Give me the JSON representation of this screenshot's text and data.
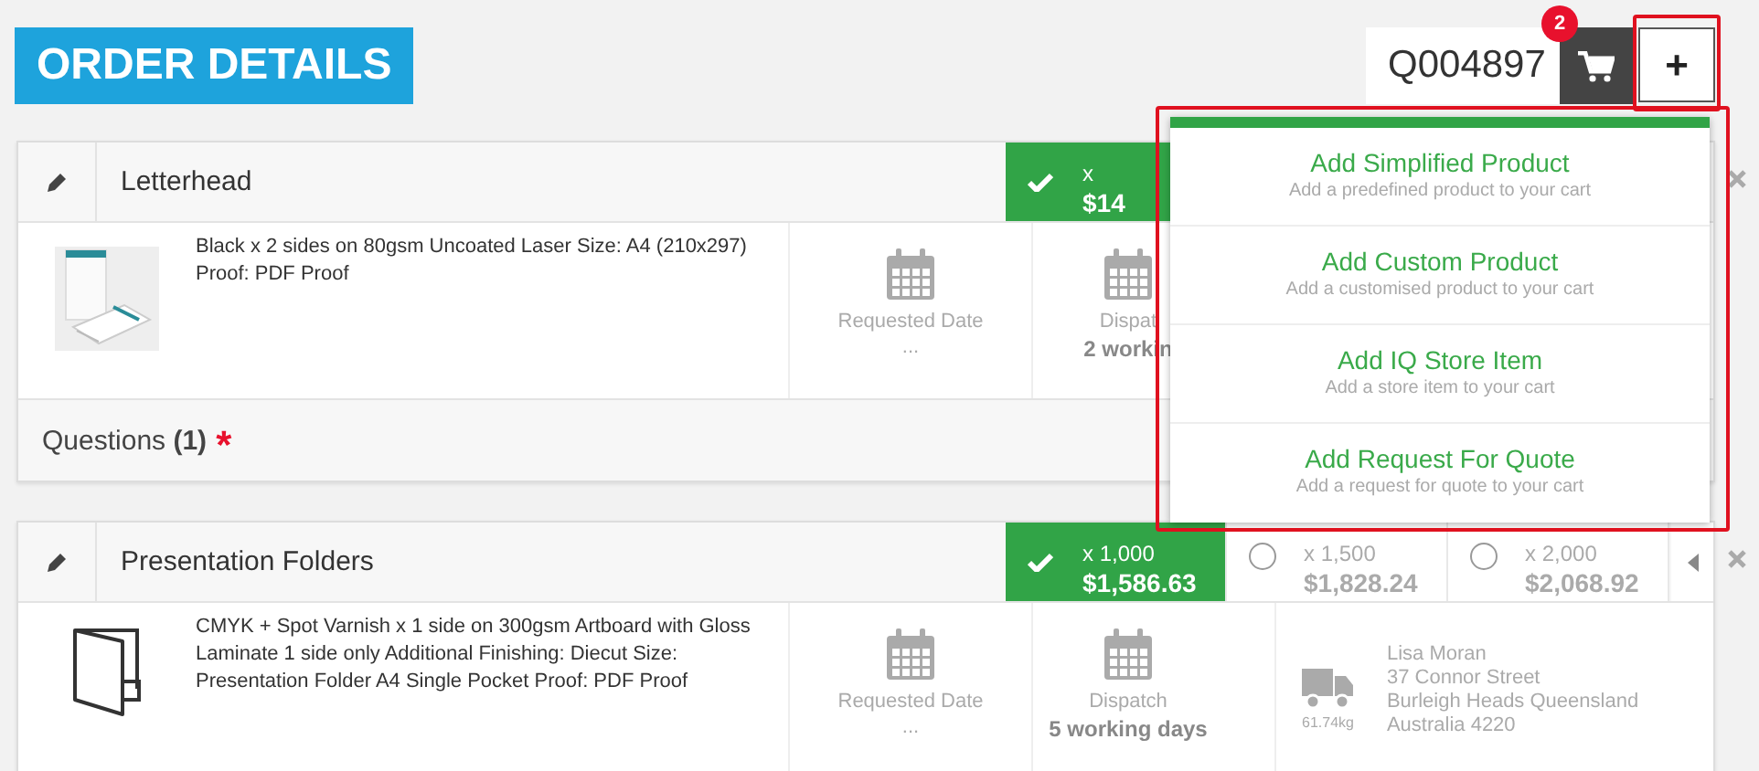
{
  "header": {
    "title": "ORDER DETAILS",
    "quote_number": "Q004897",
    "cart_count": "2",
    "add_label": "+"
  },
  "items": [
    {
      "name": "Letterhead",
      "thumbnail": {
        "kind": "picture"
      },
      "description": "Black x 2 sides on 80gsm Uncoated Laser Size: A4 (210x297) Proof: PDF Proof",
      "options": [
        {
          "quantity": "x",
          "price": "$14",
          "selected": true
        }
      ],
      "requested_label": "Requested Date",
      "requested_value": "...",
      "dispatch_label": "Dispat",
      "dispatch_value": "2 workin",
      "questions": {
        "label": "Questions **(1)**",
        "required_mark": "*"
      }
    },
    {
      "name": "Presentation Folders",
      "thumbnail": {
        "kind": "folder"
      },
      "description": "CMYK + Spot Varnish x 1 side on 300gsm Artboard with Gloss Laminate 1 side only Additional Finishing: Diecut Size: Presentation Folder A4 Single Pocket Proof: PDF Proof",
      "options": [
        {
          "quantity": "x 1,000",
          "price": "$1,586.63",
          "selected": true
        },
        {
          "quantity": "x 1,500",
          "price": "$1,828.24",
          "selected": false
        },
        {
          "quantity": "x 2,000",
          "price": "$2,068.92",
          "selected": false
        }
      ],
      "requested_label": "Requested Date",
      "requested_value": "...",
      "dispatch_label": "Dispatch",
      "dispatch_value": "5 working days",
      "delivery": {
        "weight": "61.74kg",
        "address": [
          "Lisa Moran",
          "37 Connor Street",
          "Burleigh Heads Queensland",
          "Australia 4220"
        ]
      }
    }
  ],
  "add_menu": {
    "items": [
      {
        "title": "Add Simplified Product",
        "subtitle": "Add a predefined product to your cart"
      },
      {
        "title": "Add Custom Product",
        "subtitle": "Add a customised product to your cart"
      },
      {
        "title": "Add IQ Store Item",
        "subtitle": "Add a store item to your cart"
      },
      {
        "title": "Add Request For Quote",
        "subtitle": "Add a request for quote to your cart"
      }
    ]
  }
}
